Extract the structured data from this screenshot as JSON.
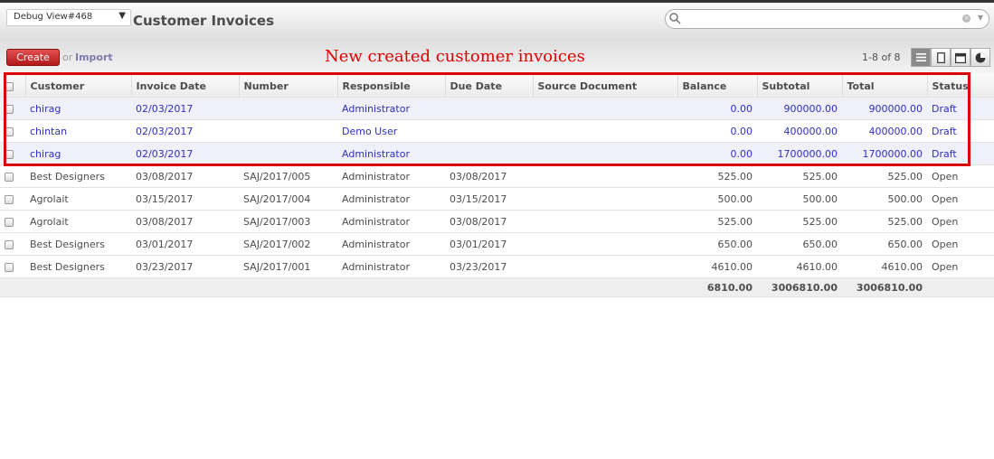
{
  "header": {
    "debug_select": "Debug View#468",
    "title": "Customer Invoices",
    "search_value": ""
  },
  "toolbar": {
    "create_label": "Create",
    "or_label": "or",
    "import_label": "Import",
    "pager": "1-8 of 8",
    "annotation": "New created customer invoices",
    "view_icons": [
      "list-view-icon",
      "form-view-icon",
      "calendar-view-icon",
      "graph-view-icon"
    ]
  },
  "table": {
    "columns": [
      "Customer",
      "Invoice Date",
      "Number",
      "Responsible",
      "Due Date",
      "Source Document",
      "Balance",
      "Subtotal",
      "Total",
      "Status"
    ],
    "rows": [
      [
        "chirag",
        "02/03/2017",
        "",
        "Administrator",
        "",
        "",
        "0.00",
        "900000.00",
        "900000.00",
        "Draft"
      ],
      [
        "chintan",
        "02/03/2017",
        "",
        "Demo User",
        "",
        "",
        "0.00",
        "400000.00",
        "400000.00",
        "Draft"
      ],
      [
        "chirag",
        "02/03/2017",
        "",
        "Administrator",
        "",
        "",
        "0.00",
        "1700000.00",
        "1700000.00",
        "Draft"
      ],
      [
        "Best Designers",
        "03/08/2017",
        "SAJ/2017/005",
        "Administrator",
        "03/08/2017",
        "",
        "525.00",
        "525.00",
        "525.00",
        "Open"
      ],
      [
        "Agrolait",
        "03/15/2017",
        "SAJ/2017/004",
        "Administrator",
        "03/15/2017",
        "",
        "500.00",
        "500.00",
        "500.00",
        "Open"
      ],
      [
        "Agrolait",
        "03/08/2017",
        "SAJ/2017/003",
        "Administrator",
        "03/08/2017",
        "",
        "525.00",
        "525.00",
        "525.00",
        "Open"
      ],
      [
        "Best Designers",
        "03/01/2017",
        "SAJ/2017/002",
        "Administrator",
        "03/01/2017",
        "",
        "650.00",
        "650.00",
        "650.00",
        "Open"
      ],
      [
        "Best Designers",
        "03/23/2017",
        "SAJ/2017/001",
        "Administrator",
        "03/23/2017",
        "",
        "4610.00",
        "4610.00",
        "4610.00",
        "Open"
      ]
    ],
    "totals": {
      "balance": "6810.00",
      "subtotal": "3006810.00",
      "total": "3006810.00"
    }
  },
  "colors": {
    "draft_text": "#2f2fc4",
    "annotation": "#dd0000",
    "create_button": "#c12a2a"
  }
}
